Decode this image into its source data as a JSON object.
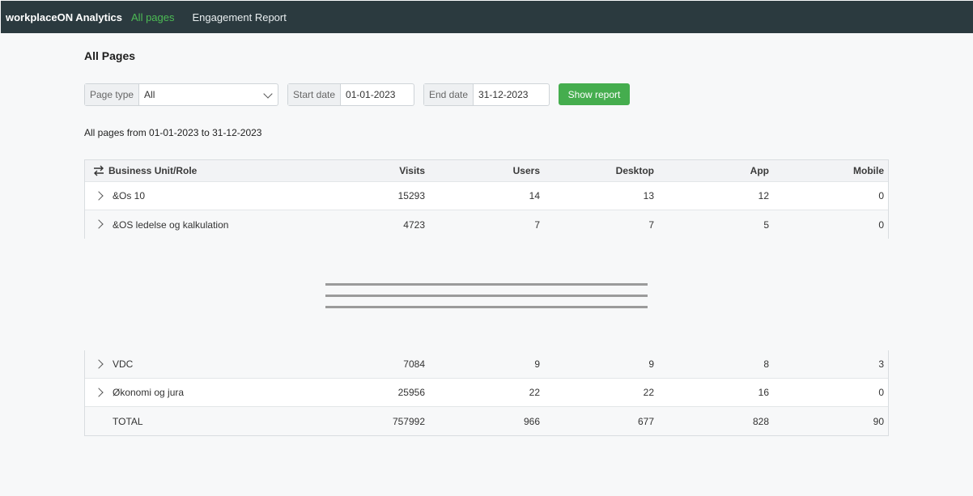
{
  "navbar": {
    "brand": "workplaceON Analytics",
    "links": [
      "All pages",
      "Engagement Report"
    ]
  },
  "page": {
    "title": "All Pages"
  },
  "filters": {
    "page_type_label": "Page type",
    "page_type_value": "All",
    "start_label": "Start date",
    "start_value": "01-01-2023",
    "end_label": "End date",
    "end_value": "31-12-2023",
    "show_button": "Show report"
  },
  "summary": "All pages from 01-01-2023 to 31-12-2023",
  "table": {
    "headers": [
      "Business Unit/Role",
      "Visits",
      "Users",
      "Desktop",
      "App",
      "Mobile"
    ],
    "rows_top": [
      {
        "name": "&Os 10",
        "visits": "15293",
        "users": "14",
        "desktop": "13",
        "app": "12",
        "mobile": "0"
      },
      {
        "name": "&OS ledelse og kalkulation",
        "visits": "4723",
        "users": "7",
        "desktop": "7",
        "app": "5",
        "mobile": "0"
      }
    ],
    "rows_bottom": [
      {
        "name": "VDC",
        "visits": "7084",
        "users": "9",
        "desktop": "9",
        "app": "8",
        "mobile": "3"
      },
      {
        "name": "Økonomi og jura",
        "visits": "25956",
        "users": "22",
        "desktop": "22",
        "app": "16",
        "mobile": "0"
      }
    ],
    "total": {
      "name": "TOTAL",
      "visits": "757992",
      "users": "966",
      "desktop": "677",
      "app": "828",
      "mobile": "90"
    }
  },
  "icons": {
    "sort": "swap-arrows-icon",
    "expand": "chevron-right-icon",
    "dropdown": "chevron-down-icon"
  }
}
